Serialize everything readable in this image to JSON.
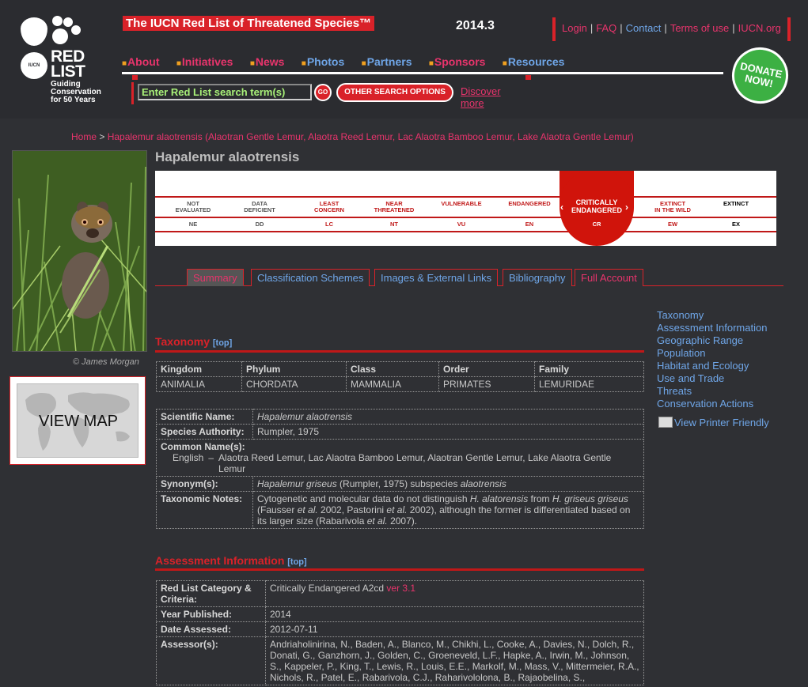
{
  "header": {
    "site_title": "The IUCN Red List of Threatened Species™",
    "version": "2014.3",
    "logo": {
      "iucn": "IUCN",
      "red_list_line1": "RED",
      "red_list_line2": "LIST",
      "tagline_1": "Guiding",
      "tagline_2": "Conservation",
      "tagline_3": "for 50 Years"
    },
    "toplinks": [
      "Login",
      "FAQ",
      "Contact",
      "Terms of use",
      "IUCN.org"
    ],
    "nav": [
      "About",
      "Initiatives",
      "News",
      "Photos",
      "Partners",
      "Sponsors",
      "Resources"
    ],
    "search_placeholder": "Enter Red List search term(s)",
    "go_label": "GO",
    "other_search": "OTHER SEARCH OPTIONS",
    "discover": "Discover more",
    "donate_line1": "DONATE",
    "donate_line2": "NOW!"
  },
  "breadcrumb": {
    "home": "Home",
    "sep": " > ",
    "current": "Hapalemur alaotrensis (Alaotran Gentle Lemur, Alaotra Reed Lemur, Lac Alaotra Bamboo Lemur, Lake Alaotra Gentle Lemur)"
  },
  "photo_credit": "© James Morgan",
  "view_map": "VIEW MAP",
  "species_name": "Hapalemur alaotrensis",
  "status_scale": {
    "categories": [
      {
        "line1": "NOT",
        "line2": "EVALUATED",
        "abbr": "NE"
      },
      {
        "line1": "DATA",
        "line2": "DEFICIENT",
        "abbr": "DD"
      },
      {
        "line1": "LEAST",
        "line2": "CONCERN",
        "abbr": "LC"
      },
      {
        "line1": "NEAR",
        "line2": "THREATENED",
        "abbr": "NT"
      },
      {
        "line1": "",
        "line2": "VULNERABLE",
        "abbr": "VU"
      },
      {
        "line1": "",
        "line2": "ENDANGERED",
        "abbr": "EN"
      },
      {
        "line1": "CRITICALLY",
        "line2": "ENDANGERED",
        "abbr": "CR"
      },
      {
        "line1": "EXTINCT",
        "line2": "IN THE WILD",
        "abbr": "EW"
      },
      {
        "line1": "",
        "line2": "EXTINCT",
        "abbr": "EX"
      }
    ],
    "current": "CR",
    "colors": {
      "threat_red": "#c01818",
      "current_bg": "#d0140b",
      "grey_text": "#555555"
    }
  },
  "tabs": [
    "Summary",
    "Classification Schemes",
    "Images & External Links",
    "Bibliography",
    "Full Account"
  ],
  "sidelinks": [
    "Taxonomy",
    "Assessment Information",
    "Geographic Range",
    "Population",
    "Habitat and Ecology",
    "Use and Trade",
    "Threats",
    "Conservation Actions"
  ],
  "printer_friendly": "View Printer Friendly",
  "taxonomy": {
    "title": "Taxonomy",
    "top": "[top]",
    "headers": [
      "Kingdom",
      "Phylum",
      "Class",
      "Order",
      "Family"
    ],
    "values": [
      "ANIMALIA",
      "CHORDATA",
      "MAMMALIA",
      "PRIMATES",
      "LEMURIDAE"
    ],
    "sci_label": "Scientific Name:",
    "sci_value": "Hapalemur alaotrensis",
    "authority_label": "Species Authority:",
    "authority_value": "Rumpler, 1975",
    "common_label": "Common Name(s):",
    "common_lang": "English",
    "common_dash": "–",
    "common_value": "Alaotra Reed Lemur, Lac Alaotra Bamboo Lemur, Alaotran Gentle Lemur, Lake Alaotra Gentle Lemur",
    "synonym_label": "Synonym(s):",
    "synonym_name": "Hapalemur griseus",
    "synonym_rest": " (Rumpler, 1975) subspecies ",
    "synonym_sub": "alaotrensis",
    "notes_label": "Taxonomic Notes:",
    "notes_1": "Cytogenetic and molecular data do not distinguish ",
    "notes_2": "H. alatorensis",
    "notes_3": " from ",
    "notes_4": "H. griseus griseus",
    "notes_5": " (Fausser ",
    "notes_6": "et al.",
    "notes_7": " 2002, Pastorini ",
    "notes_8": "et al.",
    "notes_9": " 2002), although the former is differentiated based on its larger size (Rabarivola ",
    "notes_10": "et al.",
    "notes_11": " 2007)."
  },
  "assessment": {
    "title": "Assessment Information",
    "top": "[top]",
    "category_label": "Red List Category & Criteria:",
    "category_value": "Critically Endangered A2cd ",
    "category_link": "ver 3.1",
    "year_label": "Year Published:",
    "year_value": "2014",
    "date_label": "Date Assessed:",
    "date_value": "2012-07-11",
    "assessors_label": "Assessor(s):",
    "assessors_value": "Andriaholinirina, N., Baden, A., Blanco, M., Chikhi, L., Cooke, A., Davies, N., Dolch, R., Donati, G., Ganzhorn, J., Golden, C., Groeneveld, L.F., Hapke, A., Irwin, M., Johnson, S., Kappeler, P., King, T., Lewis, R., Louis, E.E., Markolf, M., Mass, V., Mittermeier, R.A., Nichols, R., Patel, E., Rabarivola, C.J., Raharivololona, B., Rajaobelina, S.,"
  }
}
